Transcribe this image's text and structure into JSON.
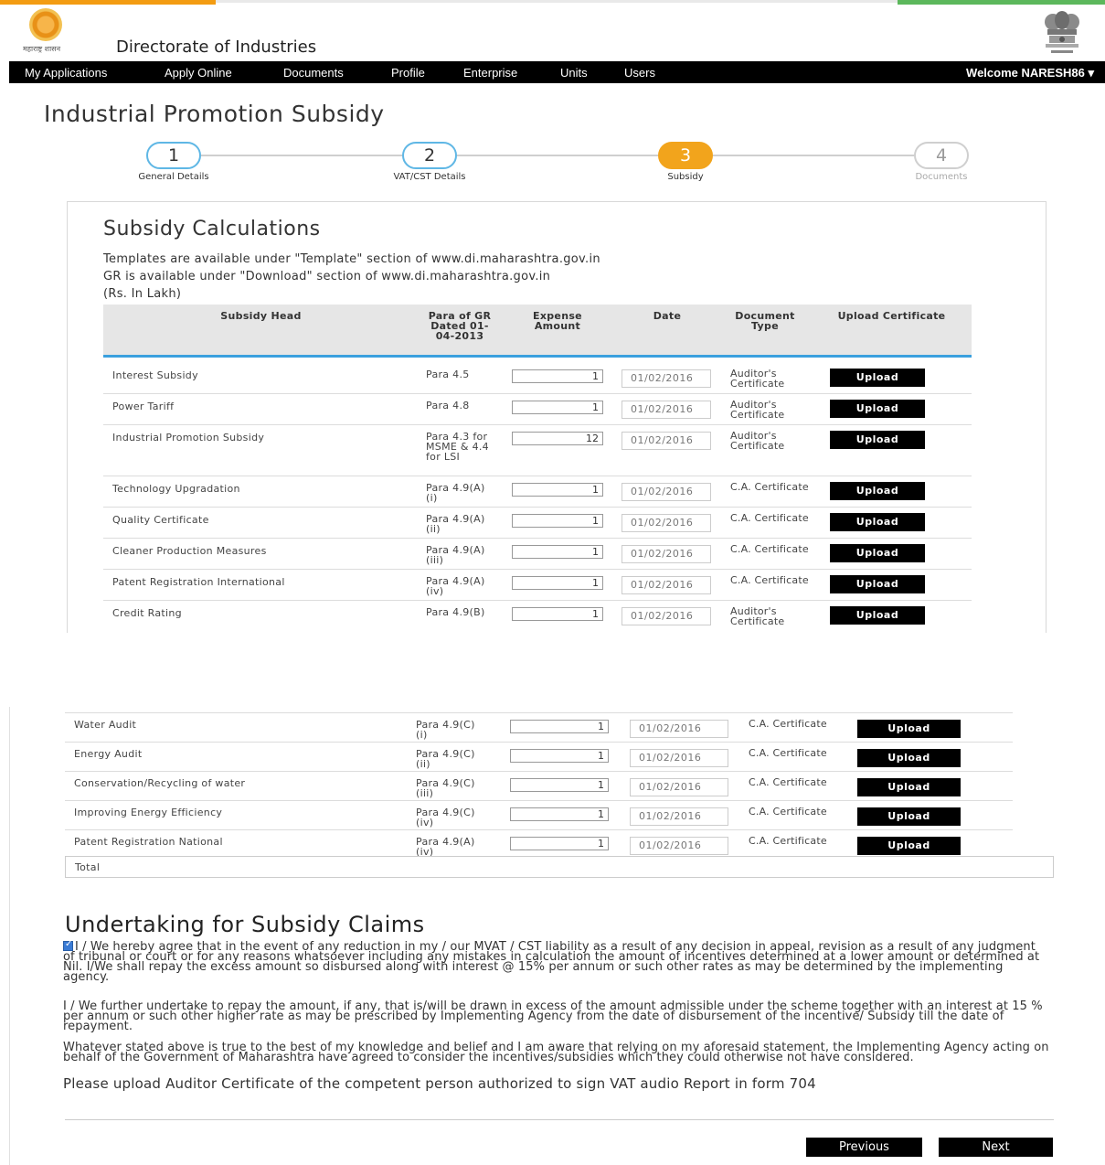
{
  "header": {
    "logo_text": "महाराष्ट्र शासन",
    "site_title": "Directorate of Industries",
    "emblem_icon": "national-emblem-icon",
    "accent_colors": [
      "#f39c12",
      "#5cb85c"
    ]
  },
  "nav": {
    "items": [
      "My Applications",
      "Apply Online",
      "Documents",
      "Profile",
      "Enterprise",
      "Units",
      "Users"
    ],
    "welcome": "Welcome NARESH86 ▾"
  },
  "page_title": "Industrial Promotion Subsidy",
  "stepper": {
    "steps": [
      {
        "num": "1",
        "label": "General Details",
        "state": "done"
      },
      {
        "num": "2",
        "label": "VAT/CST Details",
        "state": "done"
      },
      {
        "num": "3",
        "label": "Subsidy",
        "state": "active"
      },
      {
        "num": "4",
        "label": "Documents",
        "state": "disabled"
      }
    ]
  },
  "section": {
    "title": "Subsidy Calculations",
    "line1": "Templates are available under \"Template\" section of www.di.maharashtra.gov.in",
    "line2": "GR is available under \"Download\" section of www.di.maharashtra.gov.in",
    "line3": "(Rs. In Lakh)"
  },
  "table": {
    "headers": {
      "head": "Subsidy Head",
      "para": "Para of GR Dated 01-04-2013",
      "amount": "Expense Amount",
      "date": "Date",
      "doc": "Document Type",
      "upload": "Upload Certificate"
    },
    "upload_label": "Upload",
    "rows": [
      {
        "head": "Interest Subsidy",
        "para": "Para 4.5",
        "amount": "1",
        "date": "01/02/2016",
        "doc": "Auditor's Certificate"
      },
      {
        "head": "Power Tariff",
        "para": "Para 4.8",
        "amount": "1",
        "date": "01/02/2016",
        "doc": "Auditor's Certificate"
      },
      {
        "head": "Industrial Promotion Subsidy",
        "para": "Para 4.3 for MSME & 4.4 for LSI",
        "amount": "12",
        "date": "01/02/2016",
        "doc": "Auditor's Certificate"
      },
      {
        "head": "Technology Upgradation",
        "para": "Para 4.9(A)(i)",
        "amount": "1",
        "date": "01/02/2016",
        "doc": "C.A. Certificate"
      },
      {
        "head": "Quality Certificate",
        "para": "Para 4.9(A)(ii)",
        "amount": "1",
        "date": "01/02/2016",
        "doc": "C.A. Certificate"
      },
      {
        "head": "Cleaner Production Measures",
        "para": "Para 4.9(A)(iii)",
        "amount": "1",
        "date": "01/02/2016",
        "doc": "C.A. Certificate"
      },
      {
        "head": "Patent Registration International",
        "para": "Para 4.9(A)(iv)",
        "amount": "1",
        "date": "01/02/2016",
        "doc": "C.A. Certificate"
      },
      {
        "head": "Credit Rating",
        "para": "Para 4.9(B)",
        "amount": "1",
        "date": "01/02/2016",
        "doc": "Auditor's Certificate"
      }
    ],
    "rows2": [
      {
        "head": "Water Audit",
        "para": "Para 4.9(C)(i)",
        "amount": "1",
        "date": "01/02/2016",
        "doc": "C.A. Certificate"
      },
      {
        "head": "Energy Audit",
        "para": "Para 4.9(C)(ii)",
        "amount": "1",
        "date": "01/02/2016",
        "doc": "C.A. Certificate"
      },
      {
        "head": "Conservation/Recycling of water",
        "para": "Para 4.9(C)(iii)",
        "amount": "1",
        "date": "01/02/2016",
        "doc": "C.A. Certificate"
      },
      {
        "head": "Improving Energy Efficiency",
        "para": "Para 4.9(C)(iv)",
        "amount": "1",
        "date": "01/02/2016",
        "doc": "C.A. Certificate"
      },
      {
        "head": "Patent Registration National",
        "para": "Para 4.9(A)(iv)",
        "amount": "1",
        "date": "01/02/2016",
        "doc": "C.A. Certificate"
      }
    ],
    "total_label": "Total"
  },
  "undertaking": {
    "title": "Undertaking for Subsidy Claims",
    "para1": "I / We hereby agree that in the event of any reduction in my / our MVAT / CST liability as a result of any decision in appeal, revision as a result of any judgment of tribunal or court or for any reasons whatsoever including any mistakes in calculation the amount of incentives determined at a lower amount or determined at Nil. I/We shall repay the excess amount so disbursed along with interest @ 15% per annum or such other rates as may be determined by the implementing agency.",
    "para2": "I / We further undertake to repay the amount, if any, that is/will be drawn in excess of the amount admissible under the scheme together with an interest at 15 % per annum or such other higher rate as may be prescribed by Implementing Agency from the date of disbursement of the incentive/ Subsidy till the date of repayment.",
    "para3": "Whatever stated above is true to the best of my knowledge and belief and I am aware that relying on my aforesaid statement, the Implementing Agency acting on behalf of the Government of Maharashtra have agreed to consider the incentives/subsidies which they could otherwise not have considered.",
    "para4": "Please upload Auditor Certificate of the competent person authorized to sign VAT audio Report in form 704",
    "checked": true
  },
  "buttons": {
    "previous": "Previous",
    "next": "Next"
  }
}
